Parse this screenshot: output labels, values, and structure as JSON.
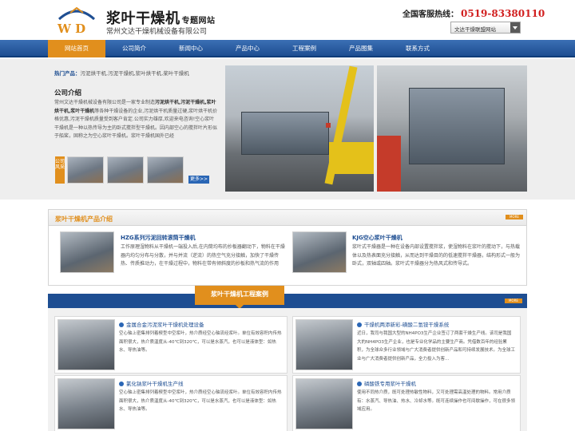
{
  "header": {
    "title": "浆叶干燥机",
    "title_suffix": "专题网站",
    "subtitle": "常州文达干燥机械设备有限公司",
    "logo_letters": "W D",
    "hotline_label": "全国客服热线：",
    "hotline_number": "0519-83380110",
    "union_select": "文达干燥联盟网站"
  },
  "nav": {
    "items": [
      "网站首页",
      "公司简介",
      "新闻中心",
      "产品中心",
      "工程案例",
      "产品图集",
      "联系方式"
    ]
  },
  "hero": {
    "hot_label": "热门产品：",
    "hot_items": "污泥烘干机,污泥干燥机,浆叶烘干机,桨叶干燥机",
    "intro_title": "公司介绍",
    "intro_text_lead": "常州文达干燥机械设备有限公司是一家专业制造",
    "intro_text_bold": "污泥烘干机,污泥干燥机,浆叶烘干机,浆叶干燥机",
    "intro_text_rest": "等各种干燥设备的企业,污泥烘干机质量过硬,浆叶烘干机价格优惠,污泥干燥机质量受到客户肯定.公司实力雄厚,欢迎来电咨询!空心浆叶干燥机是一种以热传导为主的卧式搅拌型干燥机。因内部空心的搅拌叶片形似于船桨，固称之为空心浆叶干燥机。浆叶干燥机国外已经",
    "thumbs_tab": "公司风采",
    "more": "更多>>"
  },
  "products": {
    "title": "浆叶干燥机产品介绍",
    "more": "MORE",
    "items": [
      {
        "title": "HZG系列污泥回转滚筒干燥机",
        "desc": "工作原理湿物料从干燥机一端投入后,在内筒均布的抄板器翻动下，物料在干燥器内均匀分布与分散，并与并流（逆流）的热空气充分接触，加快了干燥传热、传质推动力，在干燥过程中，物料在带有倾斜度的抄板和热气流的作用"
      },
      {
        "title": "KJG空心浆叶干燥机",
        "desc": "浆叶式干燥器是一种在设备内部设置搅拌浆，使湿物料在浆叶的搅动下，与热载体以及热表面充分接触，从而达到干燥目的的低速搅拌干燥器，结构形式一般为卧式，双轴或四轴。浆叶式干燥器分为热风式和传导式。"
      }
    ]
  },
  "cases": {
    "title": "浆叶干燥机工程案例",
    "more": "MORE",
    "items": [
      {
        "title": "金属合金污泥浆叶干燥机处理设备",
        "desc": "空心轴上密集排列着楔型中空浆叶，热介质经空心轴流经浆叶。单位有效容积内传热面积很大，热介质温度从-40℃到320℃，可以是水蒸汽，也可以是液体型：如热水、导热油等。"
      },
      {
        "title": "干燥机两添新彩-磺酸二氢铵干燥系统",
        "desc": "近日，我司与我国大型的NH4PO3生产企业签订了两套干燥生产线。该司是我国大的NH4PO3生产企业，也是专业化学品的主要生产商。凭借数百年的经验累积，为全球众多行业领域与广大消费者提供创新产品和可持续发展技术。为全球工业与广大消费者提供创新产品，全力投入为客…"
      },
      {
        "title": "氯化钠浆叶干燥机生产线",
        "desc": "空心轴上密集排列着楔型中空浆叶，热介质经空心轴流经浆叶。单位有效容积内传热面积很大，热介质温度从-40℃到320℃，可以是水蒸汽，也可以是液体型：如热水、导热油等。"
      },
      {
        "title": "磷酸铁专用浆叶干燥机",
        "desc": "使用不同热介质，既可处理热敏性物料，又可处理需高温处理的物料。常用介质有：水蒸汽、导热油、热水、冷却水等。既可连续操作也可间歇操作，可在很多领域应用。"
      }
    ]
  },
  "colors": {
    "nav_blue": "#1e4e92",
    "accent_orange": "#e18f1d",
    "hotline_red": "#d11f1f"
  }
}
